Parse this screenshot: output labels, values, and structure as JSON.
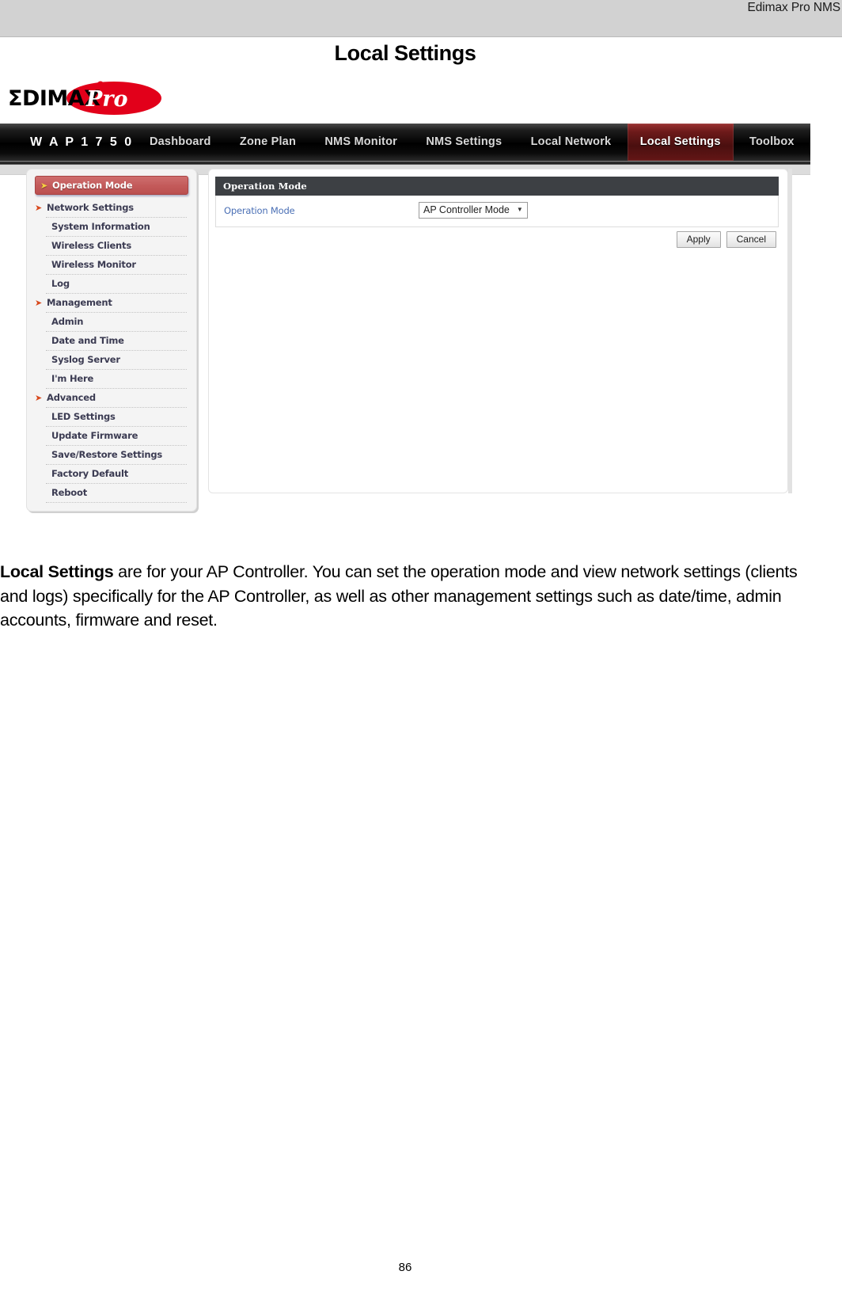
{
  "document": {
    "running_header": "Edimax Pro NMS",
    "page_title": "Local Settings",
    "page_number": "86"
  },
  "screenshot": {
    "logo_text": "EDIMAX",
    "logo_badge": "Pro",
    "navbar": {
      "brand": "W A P 1 7 5 0",
      "items": [
        {
          "label": "Dashboard",
          "active": false
        },
        {
          "label": "Zone Plan",
          "active": false
        },
        {
          "label": "NMS Monitor",
          "active": false
        },
        {
          "label": "NMS Settings",
          "active": false
        },
        {
          "label": "Local Network",
          "active": false
        },
        {
          "label": "Local Settings",
          "active": true
        },
        {
          "label": "Toolbox",
          "active": false
        }
      ],
      "active_label": "Local Settings",
      "active_color": "#6d1a1a"
    },
    "sidebar": {
      "items": [
        {
          "label": "Operation Mode",
          "type": "head",
          "selected": true
        },
        {
          "label": "Network Settings",
          "type": "head",
          "selected": false
        },
        {
          "label": "System Information",
          "type": "sub"
        },
        {
          "label": "Wireless Clients",
          "type": "sub"
        },
        {
          "label": "Wireless Monitor",
          "type": "sub"
        },
        {
          "label": "Log",
          "type": "sub"
        },
        {
          "label": "Management",
          "type": "head",
          "selected": false
        },
        {
          "label": "Admin",
          "type": "sub"
        },
        {
          "label": "Date and Time",
          "type": "sub"
        },
        {
          "label": "Syslog Server",
          "type": "sub"
        },
        {
          "label": "I'm Here",
          "type": "sub"
        },
        {
          "label": "Advanced",
          "type": "head",
          "selected": false
        },
        {
          "label": "LED Settings",
          "type": "sub"
        },
        {
          "label": "Update Firmware",
          "type": "sub"
        },
        {
          "label": "Save/Restore Settings",
          "type": "sub"
        },
        {
          "label": "Factory Default",
          "type": "sub"
        },
        {
          "label": "Reboot",
          "type": "sub"
        }
      ]
    },
    "panel": {
      "title": "Operation Mode",
      "field_label": "Operation Mode",
      "select_value": "AP Controller Mode",
      "select_options": [
        "AP Controller Mode"
      ],
      "apply_label": "Apply",
      "cancel_label": "Cancel"
    }
  },
  "paragraph": {
    "lead": "Local Settings",
    "rest": " are for your AP Controller. You can set the operation mode and view network settings (clients and logs) specifically for the AP Controller, as well as other management settings such as date/time, admin accounts, firmware and reset."
  }
}
